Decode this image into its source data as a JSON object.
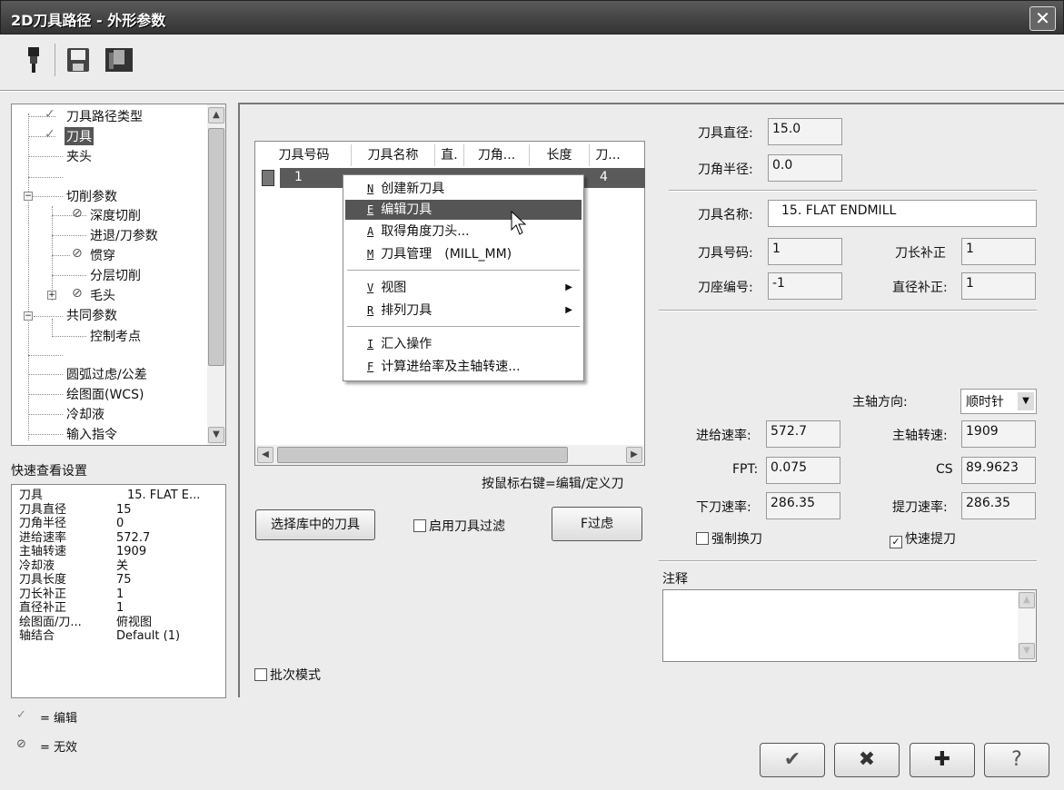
{
  "window": {
    "title": "2D刀具路径 - 外形参数",
    "close": "✕"
  },
  "toolbar": {
    "icons": [
      "tool-holder-icon",
      "save-icon",
      "save-as-icon"
    ]
  },
  "tree": [
    {
      "label": "刀具路径类型",
      "mark": "✓"
    },
    {
      "label": "刀具",
      "mark": "✓"
    },
    {
      "label": "夹头"
    },
    {
      "label": "切削参数",
      "expander": "−"
    },
    {
      "label": "深度切削",
      "mark": "⊘"
    },
    {
      "label": "进退/刀参数"
    },
    {
      "label": "惯穿",
      "mark": "⊘"
    },
    {
      "label": "分层切削"
    },
    {
      "label": "毛头",
      "mark": "⊘",
      "expander": "+"
    },
    {
      "label": "共同参数",
      "expander": "−"
    },
    {
      "label": "控制考点"
    },
    {
      "label": "圆弧过虑/公差"
    },
    {
      "label": "绘图面(WCS)"
    },
    {
      "label": "冷却液"
    },
    {
      "label": "输入指令"
    }
  ],
  "quickview": {
    "title": "快速查看设置",
    "rows": [
      [
        "刀具",
        "15. FLAT E..."
      ],
      [
        "刀具直径",
        "15"
      ],
      [
        "刀角半径",
        "0"
      ],
      [
        "进给速率",
        "572.7"
      ],
      [
        "主轴转速",
        "1909"
      ],
      [
        "冷却液",
        "关"
      ],
      [
        "刀具长度",
        "75"
      ],
      [
        "刀长补正",
        "1"
      ],
      [
        "直径补正",
        "1"
      ],
      [
        "绘图面/刀...",
        "俯视图"
      ],
      [
        "轴结合",
        "Default (1)"
      ]
    ]
  },
  "legend": {
    "edit": "= 编辑",
    "disabled": "= 无效",
    "edit_mark": "✓",
    "disabled_mark": "⊘"
  },
  "toollist": {
    "columns": [
      "刀具号码",
      "刀具名称",
      "直.",
      "刀角...",
      "长度",
      "刀..."
    ],
    "row": {
      "number": "1",
      "last": "4"
    },
    "hint": "按鼠标右键=编辑/定义刀"
  },
  "menu": [
    {
      "key": "N",
      "label": "创建新刀具"
    },
    {
      "key": "E",
      "label": "编辑刀具",
      "highlight": true
    },
    {
      "key": "A",
      "label": "取得角度刀头..."
    },
    {
      "key": "M",
      "label": "刀具管理　(MILL_MM)"
    },
    {
      "key": "V",
      "label": "视图",
      "submenu": "▶"
    },
    {
      "key": "R",
      "label": "排列刀具",
      "submenu": "▶"
    },
    {
      "key": "I",
      "label": "汇入操作"
    },
    {
      "key": "F",
      "label": "计算进给率及主轴转速..."
    }
  ],
  "buttons": {
    "select_lib": "选择库中的刀具",
    "filter_enable": "启用刀具过滤",
    "filter": "F过虑",
    "batch": "批次模式"
  },
  "params": {
    "diameter_label": "刀具直径:",
    "diameter": "15.0",
    "corner_label": "刀角半径:",
    "corner": "0.0",
    "name_label": "刀具名称:",
    "name": "15. FLAT ENDMILL",
    "number_label": "刀具号码:",
    "number": "1",
    "len_comp_label": "刀长补正",
    "len_comp": "1",
    "holder_label": "刀座编号:",
    "holder": "-1",
    "dia_comp_label": "直径补正:",
    "dia_comp": "1",
    "spindle_dir_label": "主轴方向:",
    "spindle_dir": "顺时针",
    "feed_label": "进给速率:",
    "feed": "572.7",
    "spindle_label": "主轴转速:",
    "spindle": "1909",
    "fpt_label": "FPT:",
    "fpt": "0.075",
    "cs_label": "CS",
    "cs": "89.9623",
    "plunge_label": "下刀速率:",
    "plunge": "286.35",
    "retract_label": "提刀速率:",
    "retract": "286.35",
    "force_change": "强制换刀",
    "rapid_retract": "快速提刀",
    "rapid_retract_checked": true,
    "comment_label": "注释"
  },
  "footer": {
    "ok": "✔",
    "cancel": "✖",
    "add": "✚",
    "help": "?"
  }
}
